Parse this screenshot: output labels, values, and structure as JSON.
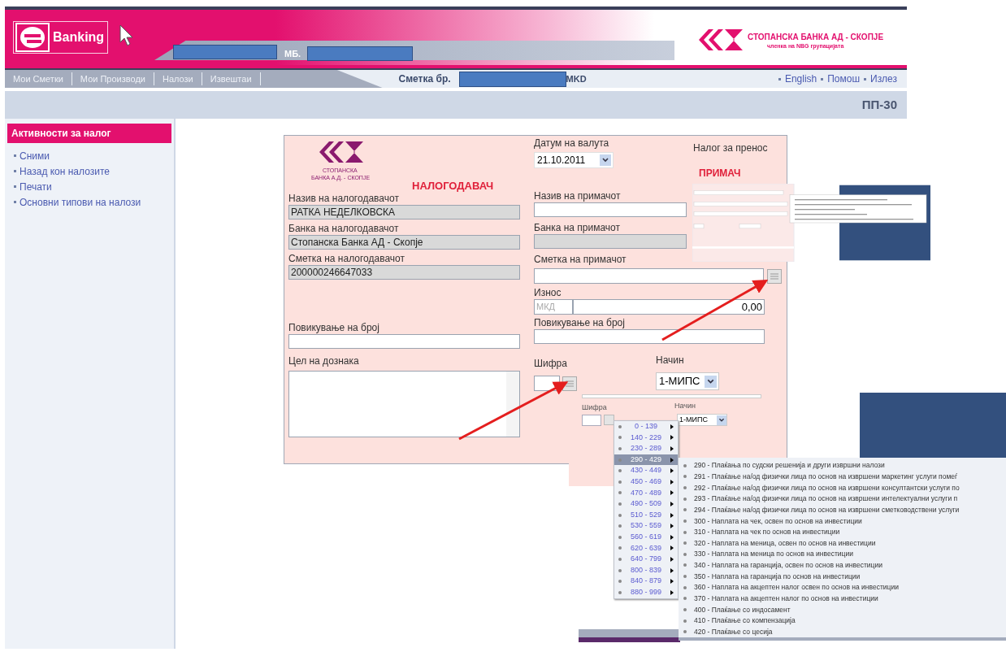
{
  "header": {
    "brand": "Banking",
    "mb_label": "МБ.",
    "bank_name": "СТОПАНСКА БАНКА АД - СКОПЈЕ",
    "bank_tagline": "членка на NBG групацијата"
  },
  "nav": {
    "items": [
      "Мои Сметки",
      "Мои Производи",
      "Налози",
      "Извештаи"
    ],
    "account_label": "Сметка бр.",
    "currency": "MKD",
    "links": [
      "English",
      "Помош",
      "Излез"
    ]
  },
  "page_title": "ПП-30",
  "sidebar": {
    "title": "Активности за налог",
    "items": [
      "Сними",
      "Назад кон налозите",
      "Печати",
      "Основни типови на налози"
    ]
  },
  "form": {
    "logo_line1": "СТОПАНСКА",
    "logo_line2": "БАНКА А.Д. - СКОПЈЕ",
    "payer_heading": "НАЛОГОДАВАЧ",
    "payee_heading": "ПРИМАЧ",
    "order_type": "Налог за пренос",
    "value_date": {
      "label": "Датум на валута",
      "value": "21.10.2011"
    },
    "payer_fields": [
      {
        "label": "Назив на налогодавачот",
        "value": "РАТКА НЕДЕЛКОВСКА",
        "disabled": true
      },
      {
        "label": "Банка на налогодавачот",
        "value": "Стопанска Банка АД -  Скопје",
        "disabled": true
      },
      {
        "label": "Сметка на налогодавачот",
        "value": "200000246647033",
        "disabled": true
      }
    ],
    "payer_reference": {
      "label": "Повикување на број"
    },
    "purpose": {
      "label": "Цел на дознака"
    },
    "payee_fields": [
      {
        "kind": "text",
        "label": "Назив на примачот",
        "disabled": false
      },
      {
        "kind": "text",
        "label": "Банка на примачот",
        "disabled": true
      },
      {
        "kind": "lookup",
        "label": "Сметка на примачот",
        "disabled": false
      },
      {
        "kind": "amount",
        "label": "Износ",
        "currency": "МКД",
        "value": "0,00",
        "disabled": false
      },
      {
        "kind": "text",
        "label": "Повикување на број",
        "disabled": false
      }
    ],
    "code": {
      "label": "Шифра"
    },
    "method": {
      "label": "Начин",
      "value": "1-МИПС"
    }
  },
  "code_picker": {
    "code_label": "Шифра",
    "method_label": "Начин",
    "method_value": "1-МИПС",
    "ranges": [
      {
        "label": "0 - 139",
        "selected": false
      },
      {
        "label": "140 - 229",
        "selected": false
      },
      {
        "label": "230 - 289",
        "selected": false
      },
      {
        "label": "290 - 429",
        "selected": true
      },
      {
        "label": "430 - 449",
        "selected": false
      },
      {
        "label": "450 - 469",
        "selected": false
      },
      {
        "label": "470 - 489",
        "selected": false
      },
      {
        "label": "490 - 509",
        "selected": false
      },
      {
        "label": "510 - 529",
        "selected": false
      },
      {
        "label": "530 - 559",
        "selected": false
      },
      {
        "label": "560 - 619",
        "selected": false
      },
      {
        "label": "620 - 639",
        "selected": false
      },
      {
        "label": "640 - 799",
        "selected": false
      },
      {
        "label": "800 - 839",
        "selected": false
      },
      {
        "label": "840 - 879",
        "selected": false
      },
      {
        "label": "880 - 999",
        "selected": false
      }
    ],
    "codes": [
      "290 - Плаќања по судски решенија и други извршни налози",
      "291 - Плаќање на/од физички лица по основ на извршени маркетинг услуги помеѓ",
      "292 - Плаќање на/од физички лица по основ на извршени консултантски услуги по",
      "293 - Плаќање на/од физички лица по основ на извршени интелектуални услуги п",
      "294 - Плаќање на/од физички лица по основ на извршени сметководствени услуги",
      "300 - Наплата на чек, освен по основ на инвестиции",
      "310 - Наплата на чек по основ на инвестиции",
      "320 - Наплата на меница, освен по основ на инвестиции",
      "330 - Наплата на меница по основ на инвестиции",
      "340 - Наплата на гаранција, освен по основ на инвестиции",
      "350 - Наплата на гаранција по основ на инвестиции",
      "360 - Наплата на акцептен налог освен по основ на инвестиции",
      "370 - Наплата на акцептен налог по основ на инвестиции",
      "400 - Плаќање со индосамент",
      "410 - Плаќање со компензација",
      "420 - Плаќање со цесија"
    ]
  }
}
